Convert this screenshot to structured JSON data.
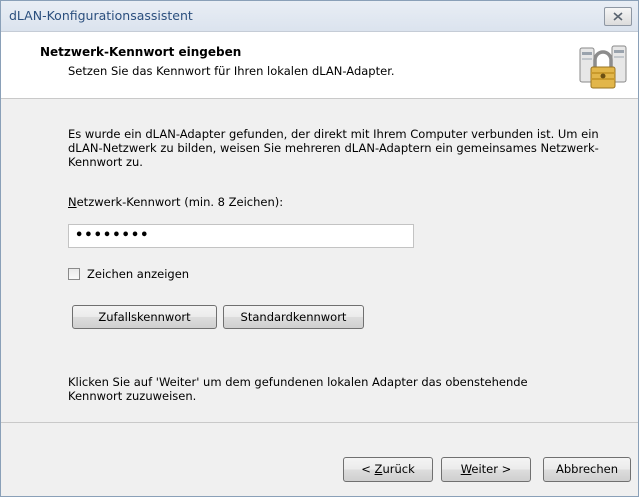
{
  "window": {
    "title": "dLAN-Konfigurationsassistent",
    "close_label": "×"
  },
  "header": {
    "title": "Netzwerk-Kennwort eingeben",
    "subtitle": "Setzen Sie das Kennwort für Ihren lokalen dLAN-Adapter.",
    "icon": "network-lock-icon"
  },
  "main": {
    "intro_text": "Es wurde ein dLAN-Adapter gefunden, der direkt mit Ihrem Computer verbunden ist. Um ein dLAN-Netzwerk zu bilden, weisen Sie mehreren dLAN-Adaptern ein gemeinsames Netzwerk-Kennwort zu.",
    "password_label_first": "N",
    "password_label_rest": "etzwerk-Kennwort (min. 8 Zeichen):",
    "password_value": "••••••••",
    "show_chars_label": "Zeichen anzeigen",
    "show_chars_checked": false,
    "random_button": "Zufallskennwort",
    "standard_button": "Standardkennwort",
    "hint_text": "Klicken Sie auf 'Weiter' um dem gefundenen lokalen Adapter das obenstehende Kennwort zuzuweisen."
  },
  "footer": {
    "back_prefix": "< ",
    "back_accel": "Z",
    "back_rest": "urück",
    "next_accel": "W",
    "next_rest": "eiter >",
    "cancel": "Abbrechen"
  }
}
